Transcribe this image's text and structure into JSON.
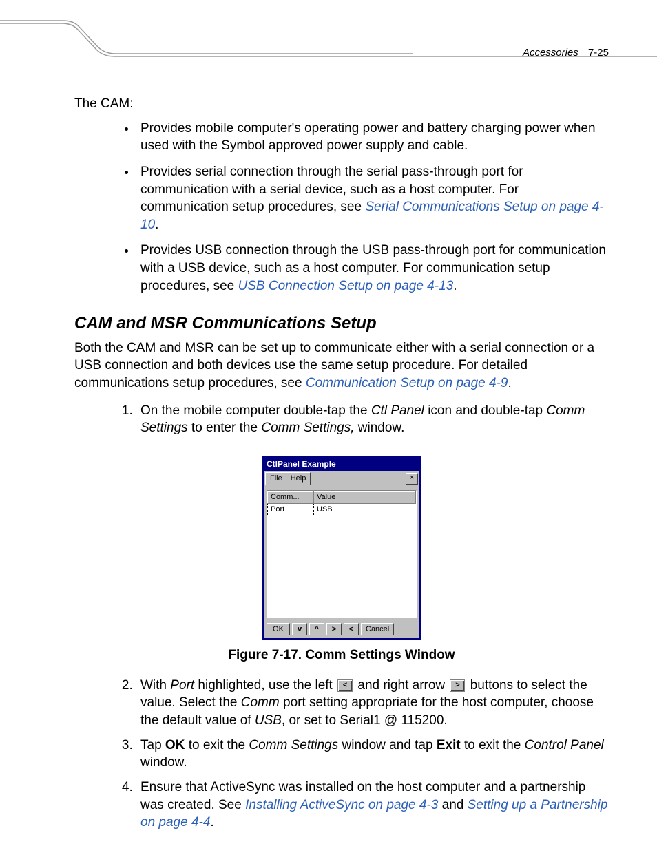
{
  "header": {
    "chapter": "Accessories",
    "page": "7-25"
  },
  "intro": {
    "lead": "The CAM:"
  },
  "bullets": [
    {
      "pre": "Provides mobile computer's operating power and battery charging power when used with the Symbol approved power supply and cable.",
      "link": "",
      "post": ""
    },
    {
      "pre": "Provides serial connection through the serial pass-through port for communication with a serial device, such as a host computer. For communication setup procedures, see ",
      "link": "Serial Communications Setup on page 4-10",
      "post": "."
    },
    {
      "pre": "Provides USB connection through the USB pass-through port for communication with a USB device, such as a host computer. For communication setup procedures, see ",
      "link": "USB Connection Setup on page 4-13",
      "post": "."
    }
  ],
  "section": {
    "heading": "CAM and MSR Communications Setup",
    "para_pre": "Both the CAM and MSR can be set up to communicate either with a serial connection or a USB connection and both devices use the same setup procedure. For detailed communications setup procedures, see ",
    "para_link": "Communication Setup on page 4-9",
    "para_post": "."
  },
  "step1": {
    "a": "On the mobile computer double-tap the ",
    "b": "Ctl Panel",
    "c": " icon and double-tap ",
    "d": "Comm Settings",
    "e": " to enter the ",
    "f": "Comm Settings,",
    "g": " window."
  },
  "figure": {
    "caption": "Figure 7-17.  Comm Settings Window"
  },
  "win": {
    "title": "CtlPanel Example",
    "menu_file": "File",
    "menu_help": "Help",
    "close": "×",
    "col1": "Comm...",
    "col2": "Value",
    "row1a": "Port",
    "row1b": "USB",
    "btn_ok": "OK",
    "btn_down": "v",
    "btn_up": "^",
    "btn_right": ">",
    "btn_left": "<",
    "btn_cancel": "Cancel"
  },
  "step2": {
    "a": "With ",
    "b": "Port",
    "c": " highlighted, use the left ",
    "left_sym": "<",
    "d": " and right arrow ",
    "right_sym": ">",
    "e": " buttons to select the value. Select the ",
    "f": "Comm",
    "g": " port setting appropriate for the host computer, choose the default value of ",
    "h": "USB",
    "i": ", or set to Serial1 @ 115200."
  },
  "step3": {
    "a": "Tap ",
    "b": "OK",
    "c": " to exit the ",
    "d": "Comm Settings",
    "e": " window and tap ",
    "f": "Exit",
    "g": " to exit the ",
    "h": "Control Panel",
    "i": " window."
  },
  "step4": {
    "a": "Ensure that ActiveSync was installed on the host computer and a partnership was created. See ",
    "link1": "Installing ActiveSync on page 4-3",
    "mid": " and ",
    "link2": "Setting up a Partnership on page 4-4",
    "post": "."
  }
}
